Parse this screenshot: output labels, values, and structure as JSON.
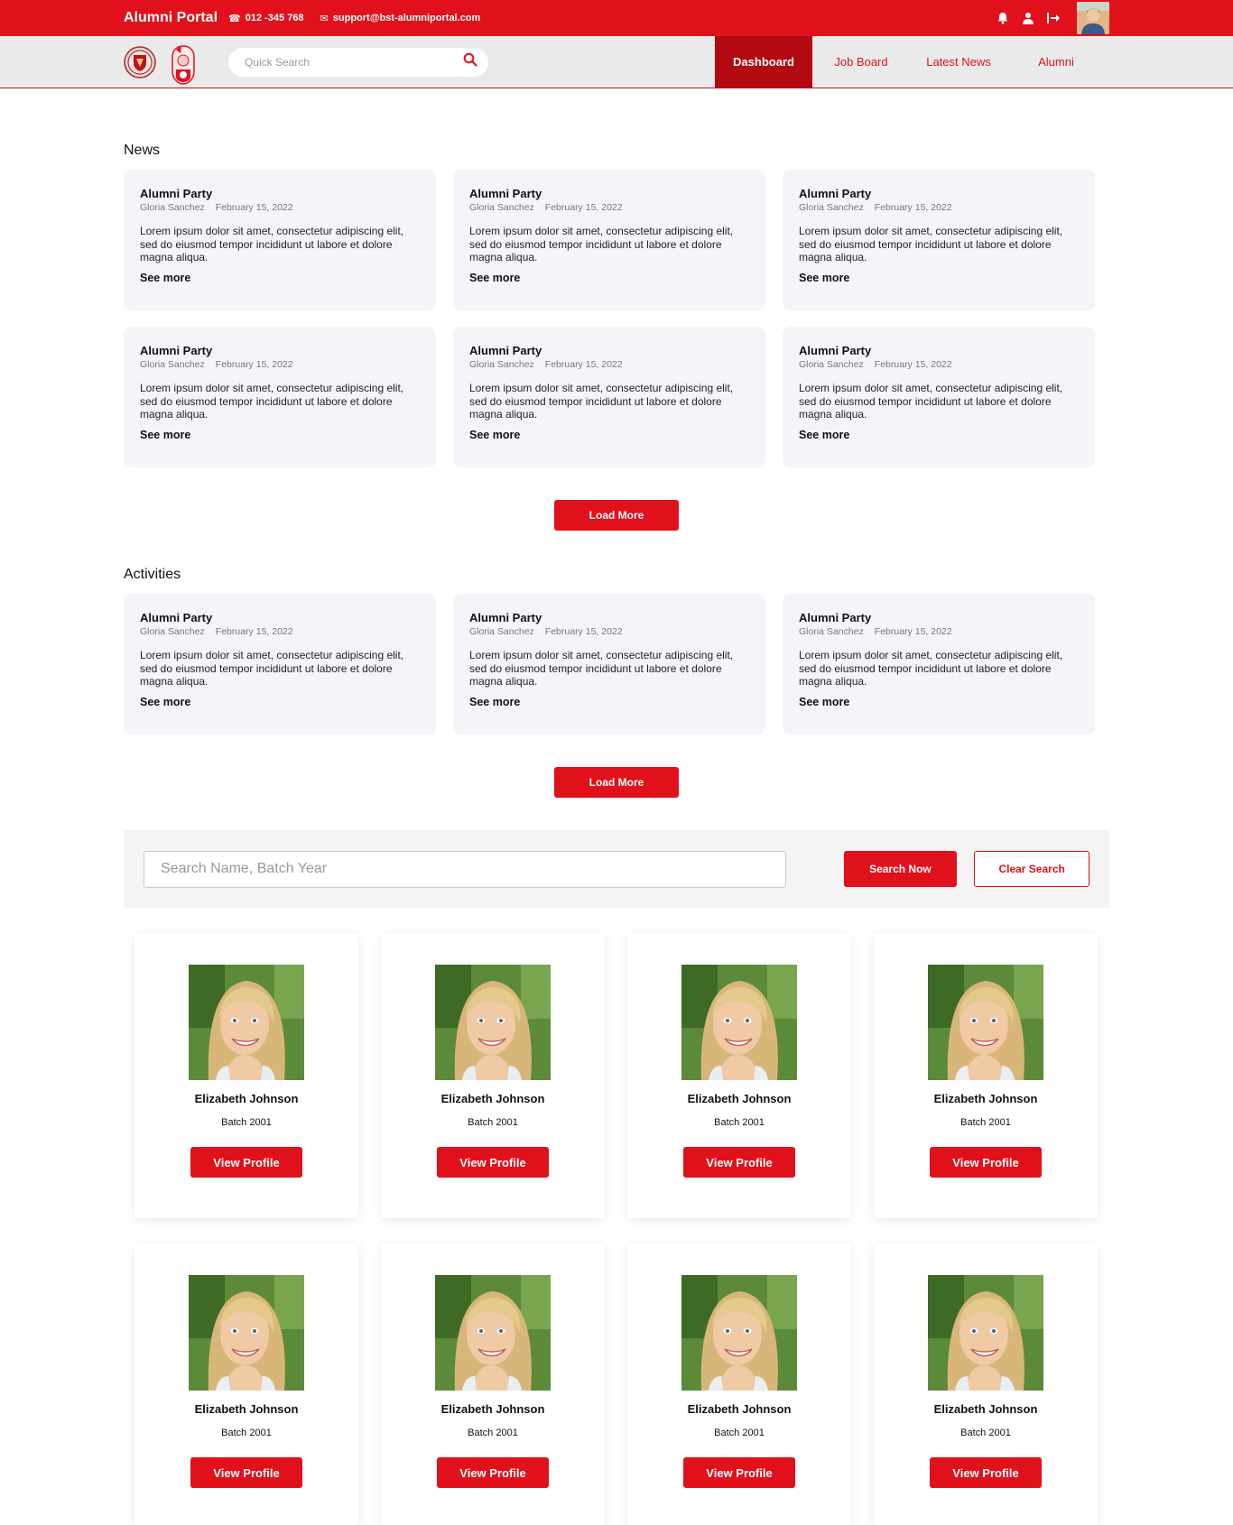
{
  "header": {
    "brand": "Alumni Portal",
    "phone": "012 -345 768",
    "email": "support@bst-alumniportal.com"
  },
  "nav": {
    "search_placeholder": "Quick Search",
    "tabs": [
      {
        "label": "Dashboard",
        "active": true
      },
      {
        "label": "Job Board",
        "active": false
      },
      {
        "label": "Latest News",
        "active": false
      },
      {
        "label": "Alumni",
        "active": false
      }
    ]
  },
  "colors": {
    "accent": "#e0111b",
    "accent_dark": "#b30a12",
    "card_bg": "#f4f5f8"
  },
  "news": {
    "title": "News",
    "load_more": "Load More",
    "items": [
      {
        "title": "Alumni Party",
        "author": "Gloria Sanchez",
        "date": "February 15, 2022",
        "body": "Lorem ipsum dolor sit amet, consectetur adipiscing elit, sed do eiusmod tempor incididunt ut labore et dolore magna aliqua.",
        "more": "See more"
      },
      {
        "title": "Alumni Party",
        "author": "Gloria Sanchez",
        "date": "February 15, 2022",
        "body": "Lorem ipsum dolor sit amet, consectetur adipiscing elit, sed do eiusmod tempor incididunt ut labore et dolore magna aliqua.",
        "more": "See more"
      },
      {
        "title": "Alumni Party",
        "author": "Gloria Sanchez",
        "date": "February 15, 2022",
        "body": "Lorem ipsum dolor sit amet, consectetur adipiscing elit, sed do eiusmod tempor incididunt ut labore et dolore magna aliqua.",
        "more": "See more"
      },
      {
        "title": "Alumni Party",
        "author": "Gloria Sanchez",
        "date": "February 15, 2022",
        "body": "Lorem ipsum dolor sit amet, consectetur adipiscing elit, sed do eiusmod tempor incididunt ut labore et dolore magna aliqua.",
        "more": "See more"
      },
      {
        "title": "Alumni Party",
        "author": "Gloria Sanchez",
        "date": "February 15, 2022",
        "body": "Lorem ipsum dolor sit amet, consectetur adipiscing elit, sed do eiusmod tempor incididunt ut labore et dolore magna aliqua.",
        "more": "See more"
      },
      {
        "title": "Alumni Party",
        "author": "Gloria Sanchez",
        "date": "February 15, 2022",
        "body": "Lorem ipsum dolor sit amet, consectetur adipiscing elit, sed do eiusmod tempor incididunt ut labore et dolore magna aliqua.",
        "more": "See more"
      }
    ]
  },
  "activities": {
    "title": "Activities",
    "load_more": "Load More",
    "items": [
      {
        "title": "Alumni Party",
        "author": "Gloria Sanchez",
        "date": "February 15, 2022",
        "body": "Lorem ipsum dolor sit amet, consectetur adipiscing elit, sed do eiusmod tempor incididunt ut labore et dolore magna aliqua.",
        "more": "See more"
      },
      {
        "title": "Alumni Party",
        "author": "Gloria Sanchez",
        "date": "February 15, 2022",
        "body": "Lorem ipsum dolor sit amet, consectetur adipiscing elit, sed do eiusmod tempor incididunt ut labore et dolore magna aliqua.",
        "more": "See more"
      },
      {
        "title": "Alumni Party",
        "author": "Gloria Sanchez",
        "date": "February 15, 2022",
        "body": "Lorem ipsum dolor sit amet, consectetur adipiscing elit, sed do eiusmod tempor incididunt ut labore et dolore magna aliqua.",
        "more": "See more"
      }
    ]
  },
  "alumni_search": {
    "placeholder": "Search Name, Batch Year",
    "search_label": "Search Now",
    "clear_label": "Clear Search"
  },
  "alumni": [
    {
      "name": "Elizabeth Johnson",
      "batch": "Batch 2001",
      "button": "View Profile"
    },
    {
      "name": "Elizabeth Johnson",
      "batch": "Batch 2001",
      "button": "View Profile"
    },
    {
      "name": "Elizabeth Johnson",
      "batch": "Batch 2001",
      "button": "View Profile"
    },
    {
      "name": "Elizabeth Johnson",
      "batch": "Batch 2001",
      "button": "View Profile"
    },
    {
      "name": "Elizabeth Johnson",
      "batch": "Batch 2001",
      "button": "View Profile"
    },
    {
      "name": "Elizabeth Johnson",
      "batch": "Batch 2001",
      "button": "View Profile"
    },
    {
      "name": "Elizabeth Johnson",
      "batch": "Batch 2001",
      "button": "View Profile"
    },
    {
      "name": "Elizabeth Johnson",
      "batch": "Batch 2001",
      "button": "View Profile"
    }
  ]
}
